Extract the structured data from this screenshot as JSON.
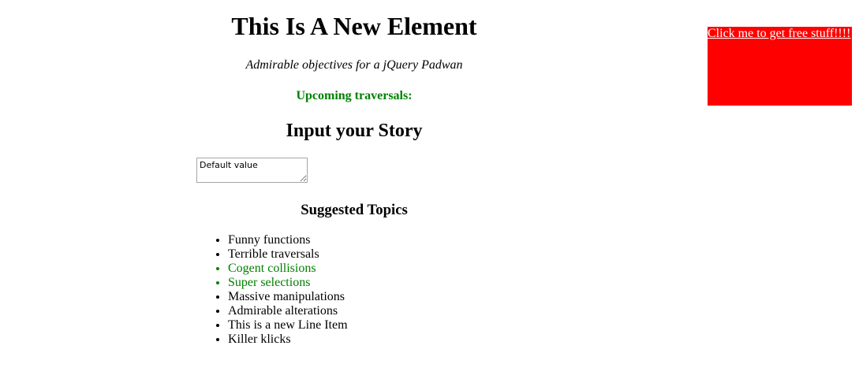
{
  "header": {
    "title": "This Is A New Element",
    "subtitle": "Admirable objectives for a jQuery Padwan",
    "upcoming": "Upcoming traversals:"
  },
  "story": {
    "heading": "Input your Story",
    "textarea_value": "Default value"
  },
  "topics": {
    "heading": "Suggested Topics",
    "items": [
      {
        "label": "Funny functions",
        "color": "#000000"
      },
      {
        "label": "Terrible traversals",
        "color": "#000000"
      },
      {
        "label": "Cogent collisions",
        "color": "#008000"
      },
      {
        "label": "Super selections",
        "color": "#008000"
      },
      {
        "label": "Massive manipulations",
        "color": "#000000"
      },
      {
        "label": "Admirable alterations",
        "color": "#000000"
      },
      {
        "label": "This is a new Line Item",
        "color": "#000000"
      },
      {
        "label": "Killer klicks",
        "color": "#000000"
      }
    ]
  },
  "promo": {
    "link_text": "Click me to get free stuff!!!!",
    "background_color": "#ff0000",
    "text_color": "#ffffff"
  },
  "colors": {
    "accent_green": "#008000"
  }
}
